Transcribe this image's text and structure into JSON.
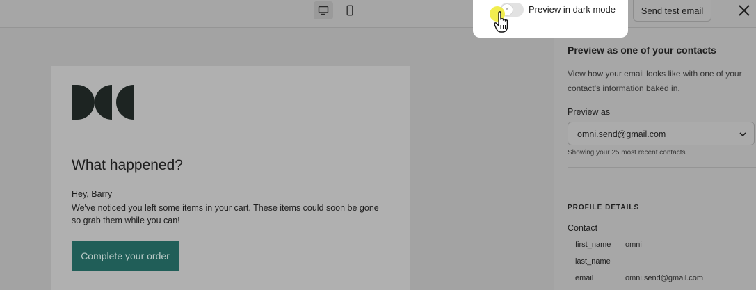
{
  "topbar": {
    "devices": [
      {
        "name": "desktop",
        "icon": "monitor-icon",
        "active": true
      },
      {
        "name": "mobile",
        "icon": "phone-icon",
        "active": false
      }
    ],
    "send_test_label": "Send test email",
    "close_icon": "close-icon"
  },
  "dark_mode": {
    "label": "Preview in dark mode",
    "enabled": false,
    "toggle_glyph": "×"
  },
  "email": {
    "heading": "What happened?",
    "greeting": "Hey, Barry",
    "body": "We've noticed you left some items in your cart. These items could soon be gone so grab them while you can!",
    "cta_label": "Complete your order",
    "cta_color": "#205e58"
  },
  "panel": {
    "title": "Preview as one of your contacts",
    "description": "View how your email looks like with one of your contact's information baked in.",
    "preview_as_label": "Preview as",
    "selected_contact": "omni.send@gmail.com",
    "recent_note": "Showing your 25 most recent contacts",
    "profile_heading": "PROFILE DETAILS",
    "contact_heading": "Contact",
    "fields": [
      {
        "key": "first_name",
        "value": "omni"
      },
      {
        "key": "last_name",
        "value": ""
      },
      {
        "key": "email",
        "value": "omni.send@gmail.com"
      }
    ]
  }
}
